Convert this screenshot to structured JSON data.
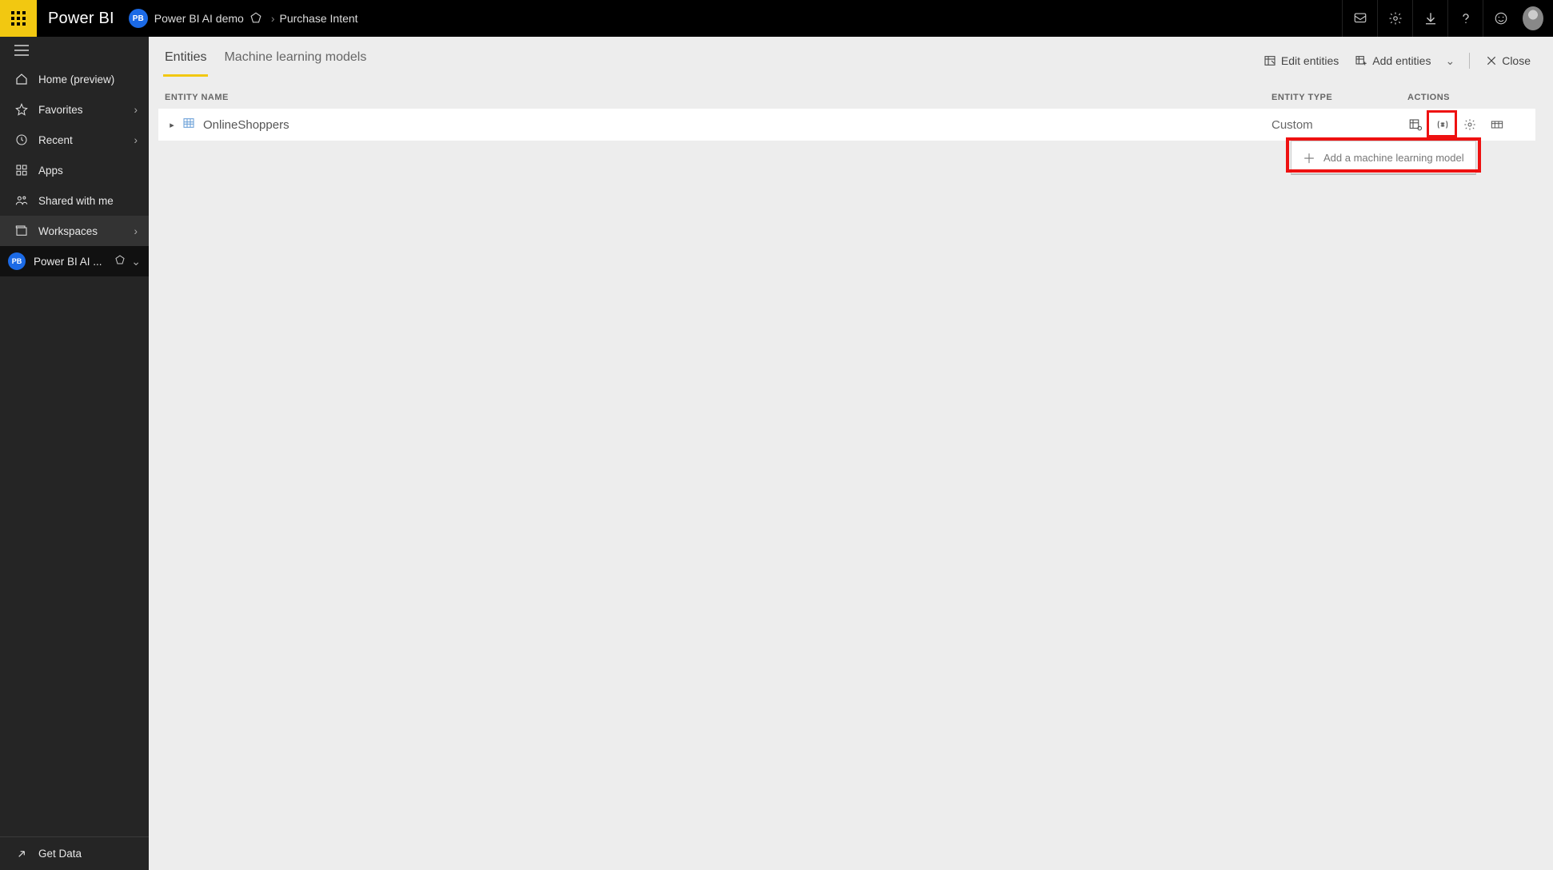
{
  "header": {
    "app_name": "Power BI",
    "workspace_pill": "PB",
    "breadcrumb": {
      "workspace": "Power BI AI demo",
      "item": "Purchase Intent"
    }
  },
  "sidebar": {
    "items": [
      {
        "label": "Home (preview)",
        "has_chevron": false
      },
      {
        "label": "Favorites",
        "has_chevron": true
      },
      {
        "label": "Recent",
        "has_chevron": true
      },
      {
        "label": "Apps",
        "has_chevron": false
      },
      {
        "label": "Shared with me",
        "has_chevron": false
      },
      {
        "label": "Workspaces",
        "has_chevron": true
      }
    ],
    "workspace_entry": {
      "badge": "PB",
      "label": "Power BI AI ..."
    },
    "footer": {
      "label": "Get Data"
    }
  },
  "content": {
    "tabs": [
      {
        "label": "Entities",
        "active": true
      },
      {
        "label": "Machine learning models",
        "active": false
      }
    ],
    "toolbar": {
      "edit_entities": "Edit entities",
      "add_entities": "Add entities",
      "close": "Close"
    },
    "table": {
      "headers": {
        "name": "ENTITY NAME",
        "type": "ENTITY TYPE",
        "actions": "ACTIONS"
      },
      "rows": [
        {
          "name": "OnlineShoppers",
          "type": "Custom"
        }
      ]
    },
    "ml_popup": "Add a machine learning model"
  }
}
